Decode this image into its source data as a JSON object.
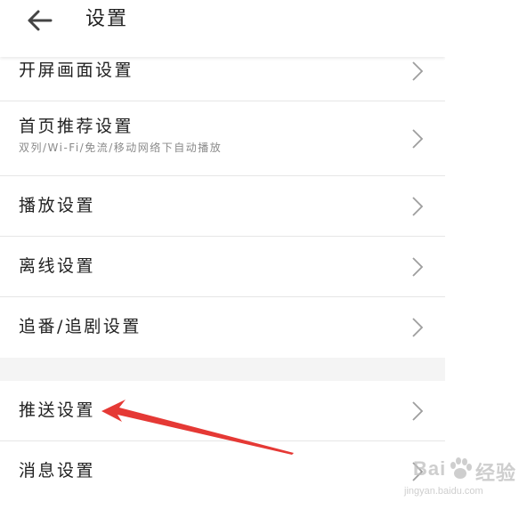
{
  "header": {
    "title": "设置",
    "back_icon": "arrow-left-icon"
  },
  "settings": {
    "group1": [
      {
        "label": "开屏画面设置",
        "subtitle": ""
      },
      {
        "label": "首页推荐设置",
        "subtitle": "双列/Wi-Fi/免流/移动网络下自动播放"
      },
      {
        "label": "播放设置",
        "subtitle": ""
      },
      {
        "label": "离线设置",
        "subtitle": ""
      },
      {
        "label": "追番/追剧设置",
        "subtitle": ""
      }
    ],
    "group2": [
      {
        "label": "推送设置",
        "subtitle": ""
      },
      {
        "label": "消息设置",
        "subtitle": ""
      }
    ]
  },
  "annotation": {
    "color": "#e53935"
  },
  "watermark": {
    "brand_latin": "Bai",
    "brand_cn": "经验",
    "url": "jingyan.baidu.com"
  },
  "colors": {
    "background": "#f4f4f4",
    "card": "#ffffff",
    "divider": "#e6e6e6",
    "text": "#212121",
    "subtext": "#8a8a8a",
    "chevron": "#9e9e9e"
  }
}
